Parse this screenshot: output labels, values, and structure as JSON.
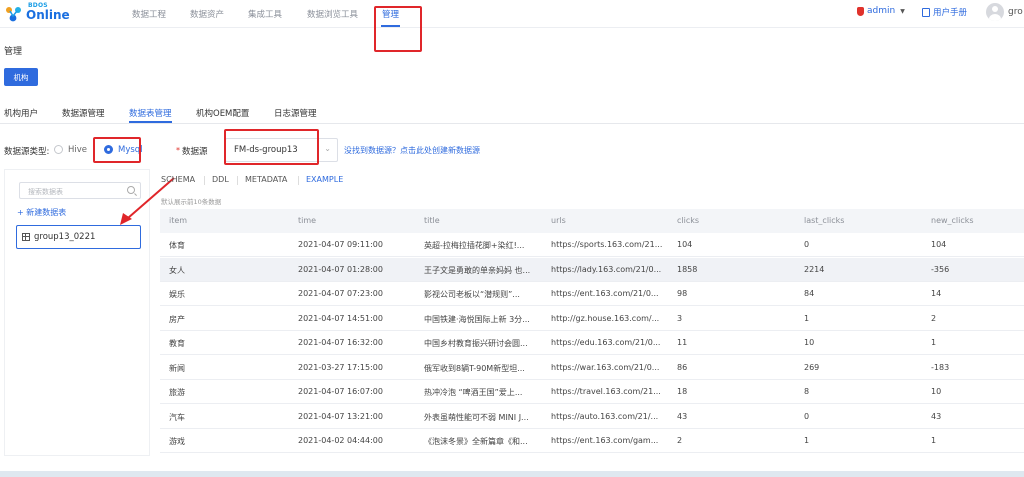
{
  "logo": {
    "small": "BDOS",
    "big": "Online"
  },
  "nav": {
    "items": [
      "数据工程",
      "数据资产",
      "集成工具",
      "数据浏览工具",
      "管理"
    ],
    "active_index": 4
  },
  "header_right": {
    "admin": "admin",
    "manual": "用户手册",
    "user": "gro"
  },
  "page_title": "管理",
  "org_button": "机构",
  "tabs": [
    "机构用户",
    "数据源管理",
    "数据表管理",
    "机构OEM配置",
    "日志源管理"
  ],
  "active_tab": "数据表管理",
  "ds_type": {
    "label": "数据源类型:",
    "options": [
      "Hive",
      "Mysql"
    ],
    "selected": "Mysql"
  },
  "datasource": {
    "required_mark": "*",
    "label": "数据源",
    "value": "FM-ds-group13",
    "link": "没找到数据源？点击此处创建新数据源"
  },
  "left": {
    "search_placeholder": "搜索数据表",
    "new_table": "+ 新建数据表",
    "table_name": "group13_0221"
  },
  "subtabs": [
    "SCHEMA",
    "DDL",
    "METADATA",
    "EXAMPLE"
  ],
  "active_subtab": "EXAMPLE",
  "hint": "默认展示前10条数据",
  "table": {
    "columns": [
      "item",
      "time",
      "title",
      "urls",
      "clicks",
      "last_clicks",
      "new_clicks"
    ],
    "rows": [
      [
        "体育",
        "2021-04-07 09:11:00",
        "英超-拉梅拉插花脚+染红!...",
        "https://sports.163.com/21...",
        "104",
        "0",
        "104"
      ],
      [
        "女人",
        "2021-04-07 01:28:00",
        "王子文是勇敢的单亲妈妈 也...",
        "https://lady.163.com/21/0...",
        "1858",
        "2214",
        "-356"
      ],
      [
        "娱乐",
        "2021-04-07 07:23:00",
        "影视公司老板以“潜规则”...",
        "https://ent.163.com/21/0...",
        "98",
        "84",
        "14"
      ],
      [
        "房产",
        "2021-04-07 14:51:00",
        "中国铁建·海悦国际上新 3分...",
        "http://gz.house.163.com/...",
        "3",
        "1",
        "2"
      ],
      [
        "教育",
        "2021-04-07 16:32:00",
        "中国乡村教育振兴研讨会圆...",
        "https://edu.163.com/21/0...",
        "11",
        "10",
        "1"
      ],
      [
        "新闻",
        "2021-03-27 17:15:00",
        "俄军收到8辆T-90M新型坦...",
        "https://war.163.com/21/0...",
        "86",
        "269",
        "-183"
      ],
      [
        "旅游",
        "2021-04-07 16:07:00",
        "热冲冷泡 “啤酒王国”爱上...",
        "https://travel.163.com/21...",
        "18",
        "8",
        "10"
      ],
      [
        "汽车",
        "2021-04-07 13:21:00",
        "外表虽萌性能可不弱 MINI J...",
        "https://auto.163.com/21/...",
        "43",
        "0",
        "43"
      ],
      [
        "游戏",
        "2021-04-02 04:44:00",
        "《泡沫冬景》全新篇章《和...",
        "https://ent.163.com/gam...",
        "2",
        "1",
        "1"
      ]
    ]
  },
  "colors": {
    "accent": "#2f6bde",
    "highlight": "#e0262a"
  }
}
